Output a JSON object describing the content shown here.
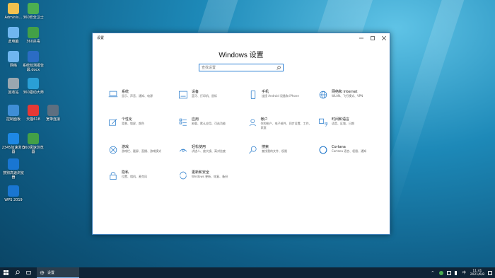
{
  "desktop": {
    "icons": [
      {
        "label": "Adminis…",
        "icon": "user-folder-icon",
        "color": "#f2c14e"
      },
      {
        "label": "360安全卫士",
        "icon": "360-security-icon",
        "color": "#4caf50"
      },
      {
        "label": "此电脑",
        "icon": "computer-icon",
        "color": "#6fb6f0"
      },
      {
        "label": "360杀毒",
        "icon": "360-antivirus-icon",
        "color": "#43a047"
      },
      {
        "label": "网络",
        "icon": "network-icon",
        "color": "#6fb6f0"
      },
      {
        "label": "系统检测报告\n最.docx",
        "icon": "word-doc-icon",
        "color": "#2b6cc4"
      },
      {
        "label": "回收站",
        "icon": "recycle-bin-icon",
        "color": "#9aa7b0"
      },
      {
        "label": "360驱动大师",
        "icon": "360-driver-icon",
        "color": "#2a9fd6"
      },
      {
        "label": "控制面板",
        "icon": "control-panel-icon",
        "color": "#3f8ed6"
      },
      {
        "label": "天猫618",
        "icon": "tmall-icon",
        "color": "#e53935"
      },
      {
        "label": "宽带连接",
        "icon": "broadband-icon",
        "color": "#5d6f80"
      },
      {
        "label": "2345加速浏览器",
        "icon": "2345-browser-icon",
        "color": "#1e88e5"
      },
      {
        "label": "360极速浏览器",
        "icon": "360-browser-icon",
        "color": "#43a047"
      },
      {
        "label": "搜狗高速浏览器",
        "icon": "sogou-browser-icon",
        "color": "#1976d2"
      },
      {
        "label": "WPS 2019",
        "icon": "wps-icon",
        "color": "#1976d2"
      }
    ]
  },
  "window": {
    "title": "设置",
    "heading": "Windows 设置",
    "search_placeholder": "查找设置",
    "accent": "#1a73c8",
    "items": [
      {
        "title": "系统",
        "sub": "显示、声音、通知、电源",
        "icon": "laptop-icon"
      },
      {
        "title": "设备",
        "sub": "蓝牙、打印机、鼠标",
        "icon": "keyboard-icon"
      },
      {
        "title": "手机",
        "sub": "连接 Android 设备和 iPhone",
        "icon": "phone-icon"
      },
      {
        "title": "网络和 Internet",
        "sub": "WLAN、飞行模式、VPN",
        "icon": "globe-icon"
      },
      {
        "title": "个性化",
        "sub": "背景、锁屏、颜色",
        "icon": "brush-icon"
      },
      {
        "title": "应用",
        "sub": "卸载、默认应用、可选功能",
        "icon": "apps-icon"
      },
      {
        "title": "帐户",
        "sub": "你的帐户、电子邮件、同步设置、工作、家庭",
        "icon": "person-icon"
      },
      {
        "title": "时间和语言",
        "sub": "语音、区域、日期",
        "icon": "time-language-icon"
      },
      {
        "title": "游戏",
        "sub": "游戏栏、截屏、直播、游戏模式",
        "icon": "xbox-icon"
      },
      {
        "title": "轻松使用",
        "sub": "讲述人、放大镜、高对比度",
        "icon": "ease-of-access-icon"
      },
      {
        "title": "搜索",
        "sub": "查找我的文件、权限",
        "icon": "search-icon"
      },
      {
        "title": "Cortana",
        "sub": "Cortana 语言、权限、通知",
        "icon": "cortana-icon"
      },
      {
        "title": "隐私",
        "sub": "位置、相机、麦克风",
        "icon": "lock-icon"
      },
      {
        "title": "更新和安全",
        "sub": "Windows 更新、恢复、备份",
        "icon": "update-icon"
      }
    ]
  },
  "taskbar": {
    "app_label": "设置",
    "time": "11:41",
    "date": "2021/6/8"
  }
}
